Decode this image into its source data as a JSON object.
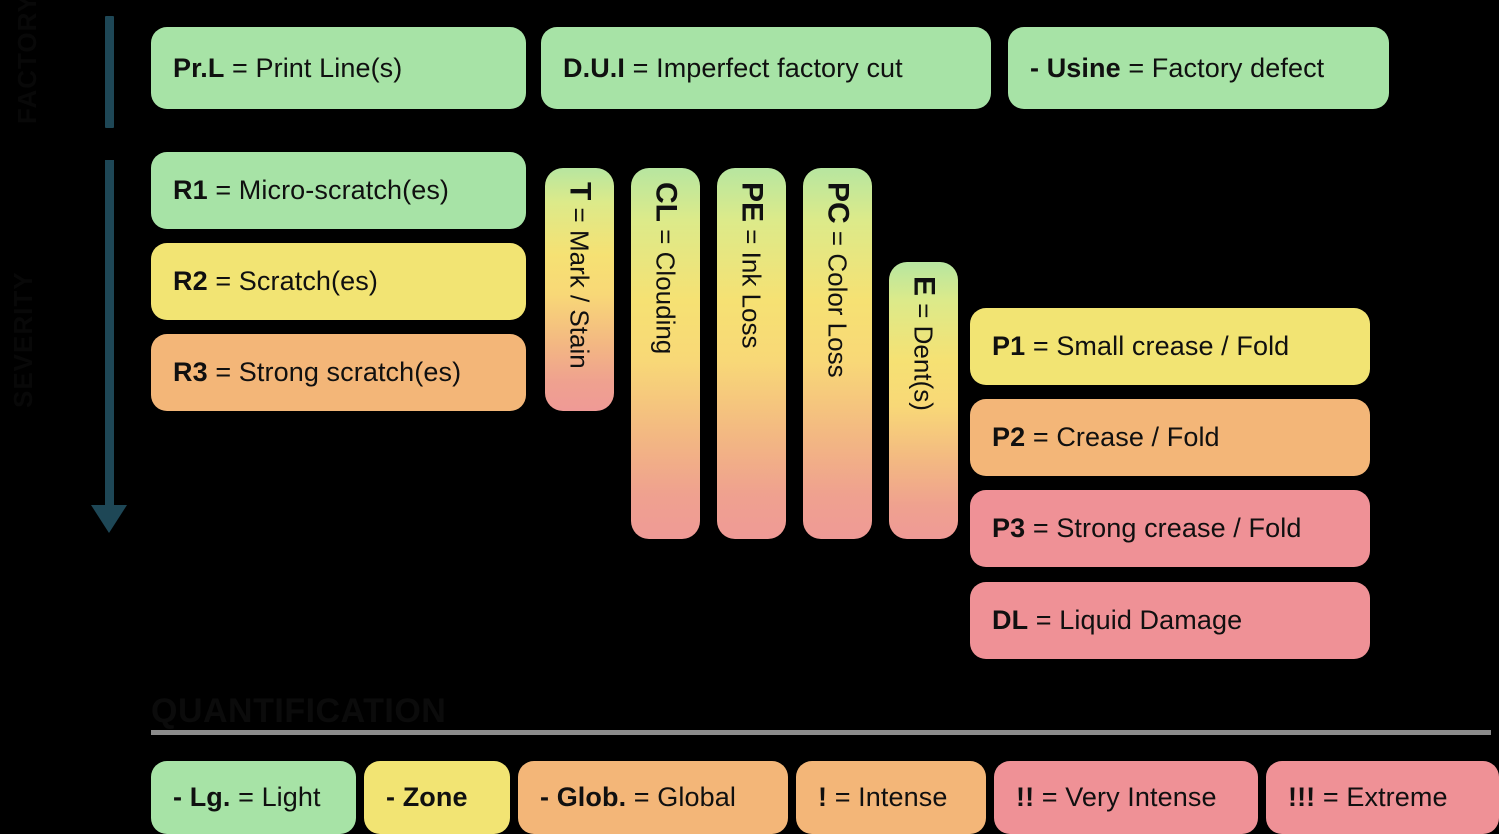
{
  "meta": {
    "background": "#000000",
    "axis_color": "#1e4756",
    "rule_color": "#8c8c8c",
    "colors": {
      "green": "#a7e3a6",
      "yellow": "#f2e473",
      "orange": "#f3b678",
      "pink": "#ef9196",
      "gradient_top": "#b7e6a0",
      "gradient_mid": "#f6e173",
      "gradient_bottom": "#ef9a96"
    }
  },
  "side_captions": [
    {
      "text": "FACTORY"
    },
    {
      "text": "SEVERITY"
    }
  ],
  "top_row": [
    {
      "code": "Pr.L",
      "sep": " = ",
      "desc": "Print Line(s)"
    },
    {
      "code": "D.U.I",
      "sep": " = ",
      "desc": "Imperfect factory cut"
    },
    {
      "code": "- Usine",
      "sep": " = ",
      "desc": "Factory defect"
    }
  ],
  "scratch_column": [
    {
      "code": "R1",
      "sep": " = ",
      "desc": "Micro-scratch(es)"
    },
    {
      "code": "R2",
      "sep": " = ",
      "desc": "Scratch(es)"
    },
    {
      "code": "R3",
      "sep": " = ",
      "desc": "Strong scratch(es)"
    }
  ],
  "vertical_pills": [
    {
      "code": "T",
      "sep": " = ",
      "desc": "Mark / Stain"
    },
    {
      "code": "CL",
      "sep": " = ",
      "desc": "Clouding"
    },
    {
      "code": "PE",
      "sep": " = ",
      "desc": "Ink Loss"
    },
    {
      "code": "PC",
      "sep": " = ",
      "desc": "Color Loss"
    },
    {
      "code": "E",
      "sep": " = ",
      "desc": "Dent(s)"
    }
  ],
  "crease_column": [
    {
      "code": "P1",
      "sep": " = ",
      "desc": "Small crease / Fold"
    },
    {
      "code": "P2",
      "sep": " = ",
      "desc": "Crease / Fold"
    },
    {
      "code": "P3",
      "sep": " = ",
      "desc": "Strong crease / Fold"
    },
    {
      "code": "DL",
      "sep": " = ",
      "desc": "Liquid Damage"
    }
  ],
  "quantification": {
    "title": "QUANTIFICATION",
    "items": [
      {
        "code": "- Lg.",
        "sep": " = ",
        "desc": "Light"
      },
      {
        "code": "- Zone",
        "sep": "",
        "desc": ""
      },
      {
        "code": "- Glob.",
        "sep": " = ",
        "desc": "Global"
      },
      {
        "code": "!",
        "sep": " = ",
        "desc": "Intense"
      },
      {
        "code": "!!",
        "sep": " = ",
        "desc": "Very Intense"
      },
      {
        "code": "!!!",
        "sep": " = ",
        "desc": "Extreme"
      }
    ]
  }
}
